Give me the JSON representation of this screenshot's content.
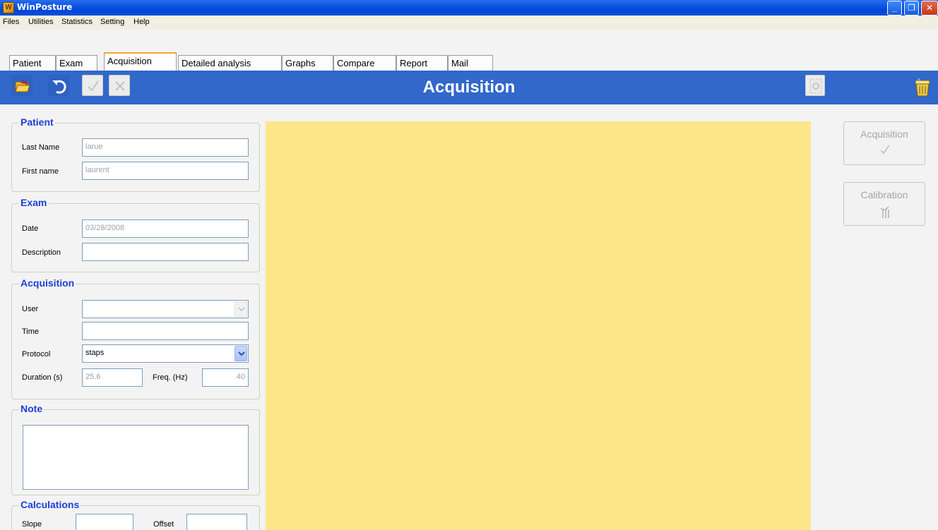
{
  "window": {
    "title": "WinPosture"
  },
  "menu": [
    "Files",
    "Utilities",
    "Statistics",
    "Setting",
    "Help"
  ],
  "tabs": [
    "Patient",
    "Exam",
    "Acquisition",
    "Detailed analysis",
    "Graphs",
    "Compare",
    "Report",
    "Mail"
  ],
  "active_tab": "Acquisition",
  "header": {
    "title": "Acquisition"
  },
  "patient": {
    "title": "Patient",
    "last_name_label": "Last Name",
    "last_name_value": "larue",
    "first_name_label": "First name",
    "first_name_value": "laurent"
  },
  "exam": {
    "title": "Exam",
    "date_label": "Date",
    "date_value": "03/28/2008",
    "description_label": "Description",
    "description_value": ""
  },
  "acquisition": {
    "title": "Acquisition",
    "user_label": "User",
    "user_value": "",
    "time_label": "Time",
    "time_value": "",
    "protocol_label": "Protocol",
    "protocol_value": "staps",
    "duration_label": "Duration (s)",
    "duration_value": "25.6",
    "freq_label": "Freq. (Hz)",
    "freq_value": "40"
  },
  "note": {
    "title": "Note",
    "value": ""
  },
  "calculations": {
    "title": "Calculations",
    "slope_label": "Slope",
    "slope_value": "",
    "offset_label": "Offset",
    "offset_value": ""
  },
  "right_buttons": {
    "acquisition_label": "Acquisition",
    "calibration_label": "Calibration"
  },
  "colors": {
    "header_bg": "#3168c9",
    "canvas_bg": "#fde68a",
    "group_title": "#1c3fd8"
  },
  "icons": [
    "open-folder-icon",
    "undo-icon",
    "checkmark-icon",
    "cancel-icon",
    "grid-settings-icon",
    "trash-bin-icon",
    "calibration-figure-icon"
  ]
}
